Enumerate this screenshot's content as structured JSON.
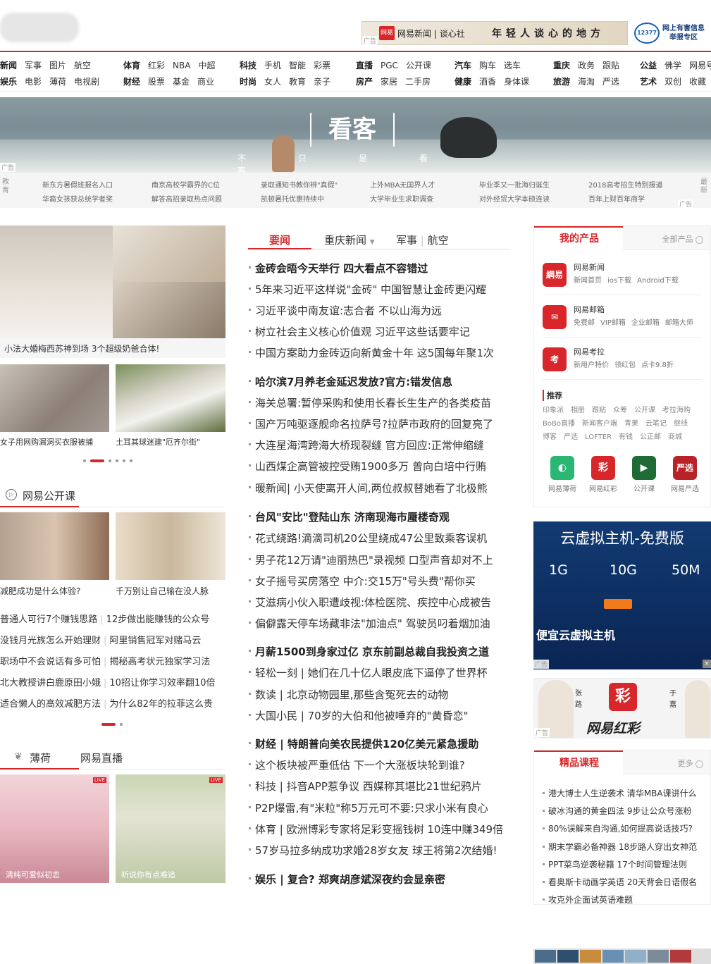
{
  "header": {
    "ad_banner": {
      "brand": "网易新闻",
      "sub": "谈心社",
      "slogan": "年轻人谈心的地方",
      "ad_tag": "广告"
    },
    "report": {
      "badge": "12377",
      "text1": "网上有害信息",
      "text2": "举报专区"
    }
  },
  "nav": [
    {
      "rows": [
        [
          "新闻",
          "军事",
          "图片",
          "航空"
        ],
        [
          "娱乐",
          "电影",
          "薄荷",
          "电视剧"
        ]
      ]
    },
    {
      "rows": [
        [
          "体育",
          "红彩",
          "NBA",
          "中超"
        ],
        [
          "财经",
          "股票",
          "基金",
          "商业"
        ]
      ]
    },
    {
      "rows": [
        [
          "科技",
          "手机",
          "智能",
          "彩票"
        ],
        [
          "时尚",
          "女人",
          "教育",
          "亲子"
        ]
      ]
    },
    {
      "rows": [
        [
          "直播",
          "PGC",
          "公开课"
        ],
        [
          "房产",
          "家居",
          "二手房"
        ]
      ]
    },
    {
      "rows": [
        [
          "汽车",
          "购车",
          "选车"
        ],
        [
          "健康",
          "酒香",
          "身体课"
        ]
      ]
    },
    {
      "rows": [
        [
          "重庆",
          "政务",
          "跟贴"
        ],
        [
          "旅游",
          "海淘",
          "严选"
        ]
      ]
    },
    {
      "rows": [
        [
          "公益",
          "佛学",
          "网易号"
        ],
        [
          "艺术",
          "双创",
          "收藏"
        ]
      ]
    }
  ],
  "hero": {
    "brand": "看客",
    "slogan": [
      "不",
      "只",
      "是",
      "看",
      "客"
    ],
    "ad_tag": "广告"
  },
  "link_strip": {
    "left_label": "教育",
    "right_label": "最新",
    "ad_tag": "广告",
    "cells": [
      [
        "新东方暑假班报名入口",
        "南京高校学霸界的C位",
        "录取通知书教你辨\"真假\"",
        "上外MBA无国界人才",
        "毕业季又一批海归诞生",
        "2018高考招生特别报道"
      ],
      [
        "华裔女孩获总统学者奖",
        "解答高招录取热点问题",
        "凯顿暑托优惠持续中",
        "大学毕业生求职调查",
        "对外经贸大学本硕连读",
        "百年上财百年商学"
      ]
    ]
  },
  "left": {
    "top_caption": "小法大婚梅西苏神到场 3个超级奶爸合体!",
    "small_captions": [
      "女子用网购漏洞买衣服被捕",
      "土耳其球迷建\"厄齐尔街\""
    ],
    "open_course": {
      "title": "网易公开课",
      "captions": [
        "减肥成功是什么体验?",
        "千万别让自己输在没人脉"
      ],
      "rows": [
        [
          "普通人可行7个赚钱思路",
          "12步做出能赚钱的公众号"
        ],
        [
          "没钱月光族怎么开始理财",
          "阿里销售冠军对赌马云"
        ],
        [
          "职场中不会说话有多可怕",
          "揭秘高考状元独家学习法"
        ],
        [
          "北大教授讲白鹿原田小娥",
          "10招让你学习效率翻10倍"
        ],
        [
          "适合懒人的高效减肥方法",
          "为什么82年的拉菲这么贵"
        ]
      ]
    },
    "live": {
      "tabs": [
        "薄荷",
        "网易直播"
      ],
      "badge": "LIVE",
      "captions": [
        "清纯可爱似初恋",
        "听说你有点难追"
      ]
    }
  },
  "middle": {
    "tabs": {
      "active": "要闻",
      "t2": "重庆新闻",
      "t3a": "军事",
      "t3b": "航空"
    },
    "groups": [
      {
        "headline": "金砖会晤今天举行 四大看点不容错过",
        "items": [
          "5年来习近平这样说\"金砖\" 中国智慧让金砖更闪耀",
          "习近平谈中南友谊:志合者 不以山海为远",
          "树立社会主义核心价值观 习近平这些话要牢记",
          "中国方案助力金砖迈向新黄金十年 这5国每年聚1次"
        ]
      },
      {
        "headline": "哈尔滨7月养老金延迟发放?官方:错发信息",
        "items": [
          "海关总署:暂停采购和使用长春长生生产的各类疫苗",
          "国产万吨驱逐舰命名拉萨号?拉萨市政府的回复亮了",
          "大连星海湾跨海大桥现裂缝 官方回应:正常伸缩缝",
          "山西煤企高管被控受贿1900多万 曾向白培中行贿",
          "暖新闻| 小天使离开人间,两位叔叔替她看了北极熊"
        ]
      },
      {
        "headline": "台风\"安比\"登陆山东 济南现海市蜃楼奇观",
        "items": [
          "花式绕路!滴滴司机20公里绕成47公里致乘客误机",
          "男子花12万请\"迪丽热巴\"录视频 口型声音却对不上",
          "女子摇号买房落空 中介:交15万\"号头费\"帮你买",
          "艾滋病小伙入职遭歧视:体检医院、疾控中心成被告",
          "偏僻露天停车场藏非法\"加油点\" 驾驶员叼着烟加油"
        ]
      },
      {
        "headline": "月薪1500到身家过亿 京东前副总裁自我投资之道",
        "items": [
          "轻松一刻 | 她们在几十亿人眼皮底下逼停了世界杯",
          "数读 | 北京动物园里,那些含冤死去的动物",
          "大国小民 | 70岁的大伯和他被唾弃的\"黄昏恋\""
        ]
      },
      {
        "headline": "财经 | 特朗普向美农民提供120亿美元紧急援助",
        "items": [
          "这个板块被严重低估 下一个大涨板块轮到谁?",
          "科技 | 抖音APP惹争议 西媒称其堪比21世纪鸦片",
          "P2P爆雷,有\"米粒\"称5万元可不要:只求小米有良心",
          "体育 | 欧洲博彩专家将足彩变摇钱树 10连中赚349倍",
          "57岁马拉多纳成功求婚28岁女友 球王将第2次结婚!"
        ]
      },
      {
        "headline": "娱乐 | 复合? 郑爽胡彦斌深夜约会显亲密",
        "items": []
      }
    ]
  },
  "right": {
    "products": {
      "title": "我的产品",
      "more": "全部产品",
      "items": [
        {
          "icon": "網易",
          "name": "网易新闻",
          "subs": [
            "新闻首页",
            "ios下载",
            "Android下载"
          ]
        },
        {
          "icon": "✉",
          "name": "网易邮箱",
          "subs": [
            "免费邮",
            "VIP邮箱",
            "企业邮箱",
            "邮箱大师"
          ]
        },
        {
          "icon": "考",
          "name": "网易考拉",
          "subs": [
            "新用户特价",
            "领红包",
            "点卡9.8折"
          ]
        }
      ],
      "rec_title": "推荐",
      "rec_rows": [
        [
          "印象派",
          "相册",
          "跟贴",
          "众筹",
          "公开课",
          "考拉海购"
        ],
        [
          "BoBo直播",
          "新闻客户端",
          "青果",
          "云笔记",
          "继线"
        ],
        [
          "博客",
          "严选",
          "LOFTER",
          "有钱",
          "公正邮",
          "商城"
        ]
      ],
      "apps": [
        {
          "icon": "◐",
          "label": "网易薄荷",
          "color": "#2bb673"
        },
        {
          "icon": "彩",
          "label": "网易红彩",
          "color": "#d8262a"
        },
        {
          "icon": "▶",
          "label": "公开课",
          "color": "#1f6b36"
        },
        {
          "icon": "严选",
          "label": "网易严选",
          "color": "#b8232a"
        }
      ]
    },
    "cloud_ad": {
      "title": "云虚拟主机-免费版",
      "specs": [
        "1G",
        "10G",
        "50M"
      ],
      "caption": "便宜云虚拟主机",
      "ad_tag": "广告"
    },
    "hongcai_ad": {
      "logo": "彩",
      "name": "网易红彩",
      "left_name": "张路",
      "right_name": "于嘉",
      "ad_tag": "广告"
    },
    "courses": {
      "title": "精品课程",
      "more": "更多",
      "items": [
        "港大博士人生逆袭术 清华MBA课讲什么",
        "破冰沟通的黄金四法 9步让公众号涨粉",
        "80%误解来自沟通,如何提高说话技巧?",
        "期末学霸必备神器 18步路人穿出女神范",
        "PPT菜鸟逆袭秘籍 17个时间管理法则",
        "看奥斯卡动画学英语 20天背会日语假名",
        "攻克外企面试英语难题"
      ]
    }
  },
  "colors": {
    "accent": "#d8262a"
  }
}
